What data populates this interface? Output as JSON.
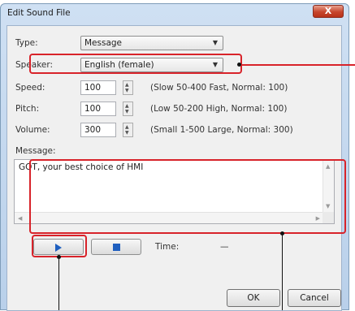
{
  "window": {
    "title": "Edit Sound File",
    "close_label": "X"
  },
  "form": {
    "type_label": "Type:",
    "type_value": "Message",
    "speaker_label": "Speaker:",
    "speaker_value": "English (female)",
    "speed_label": "Speed:",
    "speed_value": "100",
    "speed_hint": "(Slow 50-400 Fast, Normal: 100)",
    "pitch_label": "Pitch:",
    "pitch_value": "100",
    "pitch_hint": "(Low 50-200 High, Normal: 100)",
    "volume_label": "Volume:",
    "volume_value": "300",
    "volume_hint": "(Small 1-500 Large, Normal: 300)",
    "message_label": "Message:",
    "message_value": "GOT, your best choice of HMI"
  },
  "playback": {
    "time_label": "Time:",
    "time_value": "—"
  },
  "buttons": {
    "ok": "OK",
    "cancel": "Cancel"
  },
  "icons": {
    "play": "play-icon",
    "stop": "stop-icon",
    "dropdown": "chevron-down-icon"
  },
  "colors": {
    "highlight": "#d8232a",
    "media_icon": "#1f5fbf"
  }
}
